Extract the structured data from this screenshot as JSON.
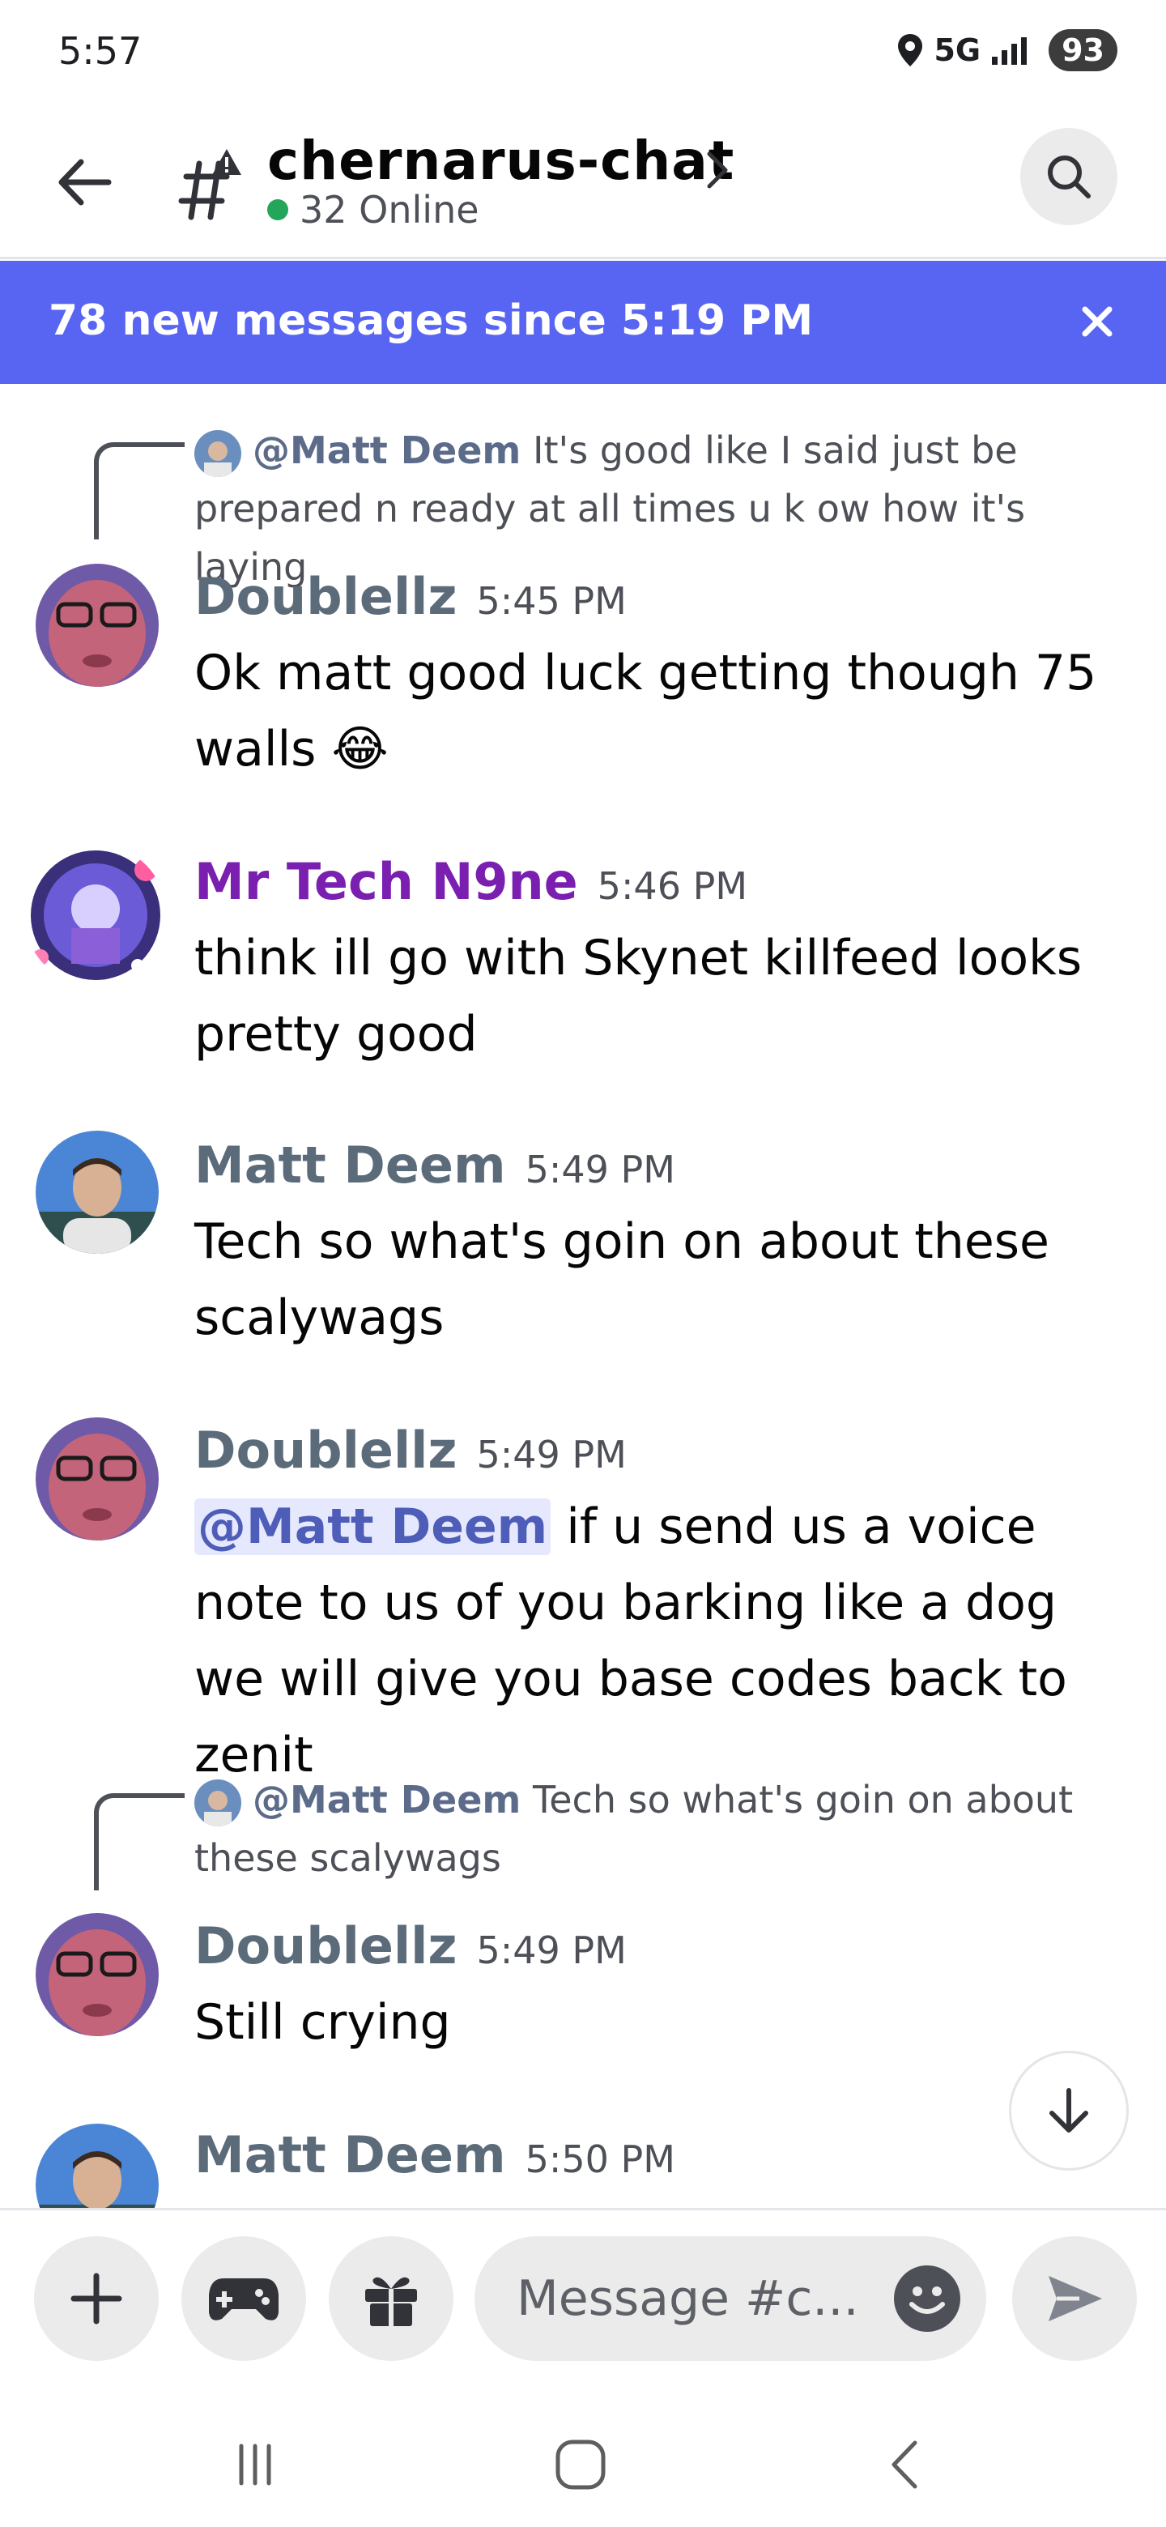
{
  "status_bar": {
    "time": "5:57",
    "network": "5G",
    "battery": "93"
  },
  "header": {
    "channel_name": "chernarus-chat",
    "online_count": "32 Online"
  },
  "new_messages_bar": {
    "text": "78 new messages since 5:19 PM"
  },
  "messages": [
    {
      "reply": {
        "mention": "@Matt Deem",
        "text": " It's good like I said just be prepared n ready at all times u k ow how it's laying"
      },
      "author": "Doublellz",
      "author_color": "#5c6b7a",
      "time": "5:45 PM",
      "text": "Ok matt good luck getting though 75 walls",
      "emoji": "😂"
    },
    {
      "author": "Mr Tech N9ne",
      "author_color": "#7a1fb0",
      "time": "5:46 PM",
      "text": "think ill go with Skynet killfeed looks pretty good"
    },
    {
      "author": "Matt Deem",
      "author_color": "#5c6b7a",
      "time": "5:49 PM",
      "text": "Tech so what's goin on about these scalywags"
    },
    {
      "author": "Doublellz",
      "author_color": "#5c6b7a",
      "time": "5:49 PM",
      "mention": "@Matt Deem",
      "text": " if u send us a voice note to us of you barking like a dog we will give you base codes back to zenit"
    },
    {
      "reply": {
        "mention": "@Matt Deem",
        "text": " Tech so what's goin on about these scalywags"
      },
      "author": "Doublellz",
      "author_color": "#5c6b7a",
      "time": "5:49 PM",
      "text": "Still crying"
    },
    {
      "author": "Matt Deem",
      "author_color": "#5c6b7a",
      "time": "5:50 PM",
      "text": ""
    }
  ],
  "composer": {
    "placeholder": "Message #c..."
  },
  "colors": {
    "accent": "#5865f2",
    "online": "#23a55a",
    "mention_bg": "#e6e9fd"
  }
}
